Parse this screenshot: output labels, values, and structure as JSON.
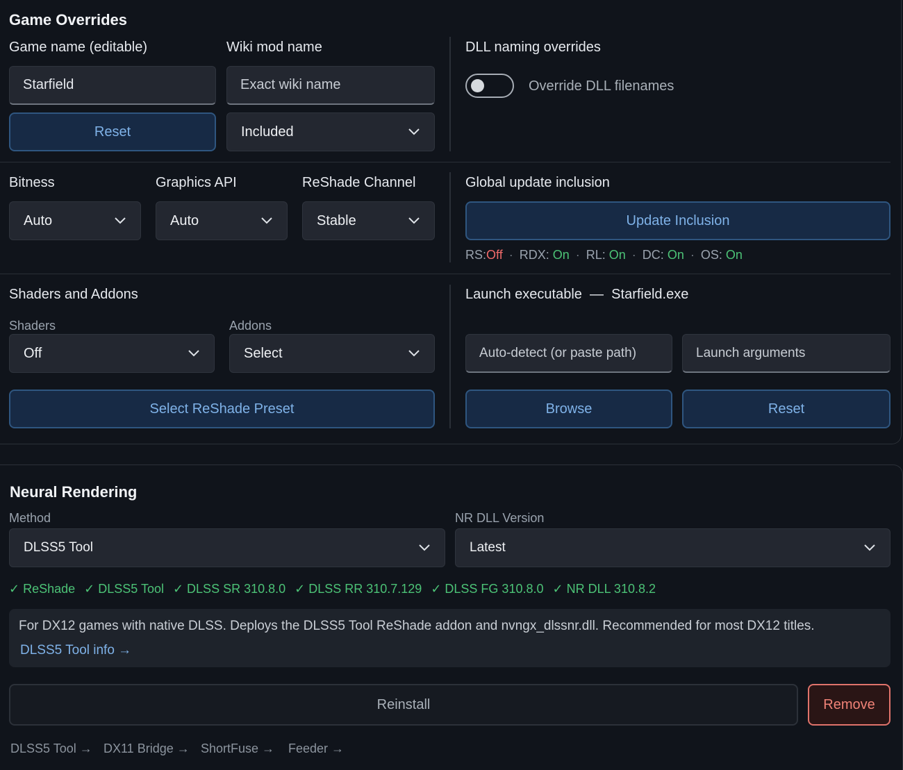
{
  "game_overrides": {
    "title": "Game Overrides",
    "game_name_label": "Game name (editable)",
    "game_name_value": "Starfield",
    "wiki_label": "Wiki mod name",
    "wiki_placeholder": "Exact wiki name",
    "reset_label": "Reset",
    "inclusion_value": "Included",
    "dll_label": "DLL naming overrides",
    "dll_toggle_label": "Override DLL filenames",
    "dll_toggle_on": false
  },
  "config": {
    "bitness_label": "Bitness",
    "bitness_value": "Auto",
    "api_label": "Graphics API",
    "api_value": "Auto",
    "channel_label": "ReShade Channel",
    "channel_value": "Stable",
    "global_label": "Global update inclusion",
    "update_button": "Update Inclusion",
    "status": [
      {
        "key": "RS:",
        "value": "Off"
      },
      {
        "key": "RDX:",
        "value": "On"
      },
      {
        "key": "RL:",
        "value": "On"
      },
      {
        "key": "DC:",
        "value": "On"
      },
      {
        "key": "OS:",
        "value": "On"
      }
    ],
    "status_sep": "·"
  },
  "shaders": {
    "title": "Shaders and Addons",
    "shaders_label": "Shaders",
    "shaders_value": "Off",
    "addons_label": "Addons",
    "addons_value": "Select",
    "preset_button": "Select ReShade Preset"
  },
  "launch": {
    "label": "Launch executable",
    "dash": "—",
    "exe": "Starfield.exe",
    "path_placeholder": "Auto-detect (or paste path)",
    "args_placeholder": "Launch arguments",
    "browse_button": "Browse",
    "reset_button": "Reset"
  },
  "neural": {
    "title": "Neural Rendering",
    "method_label": "Method",
    "method_value": "DLSS5 Tool",
    "version_label": "NR DLL Version",
    "version_value": "Latest",
    "checks": [
      "✓ ReShade",
      "✓ DLSS5 Tool",
      "✓ DLSS SR 310.8.0",
      "✓ DLSS RR 310.7.129",
      "✓ DLSS FG 310.8.0",
      "✓ NR DLL 310.8.2"
    ],
    "description": "For DX12 games with native DLSS. Deploys the DLSS5 Tool ReShade addon and nvngx_dlssnr.dll. Recommended for most DX12 titles.",
    "info_link": "DLSS5 Tool info →",
    "reinstall_button": "Reinstall",
    "remove_button": "Remove",
    "footer_links": [
      "DLSS5 Tool →",
      "DX11 Bridge →",
      "ShortFuse →",
      "Feeder →"
    ]
  },
  "colors": {
    "background": "#10141b",
    "accent_blue": "#7fb2e8",
    "on_green": "#4cc276",
    "off_red": "#f06a6a",
    "remove_border": "#e0736b"
  }
}
